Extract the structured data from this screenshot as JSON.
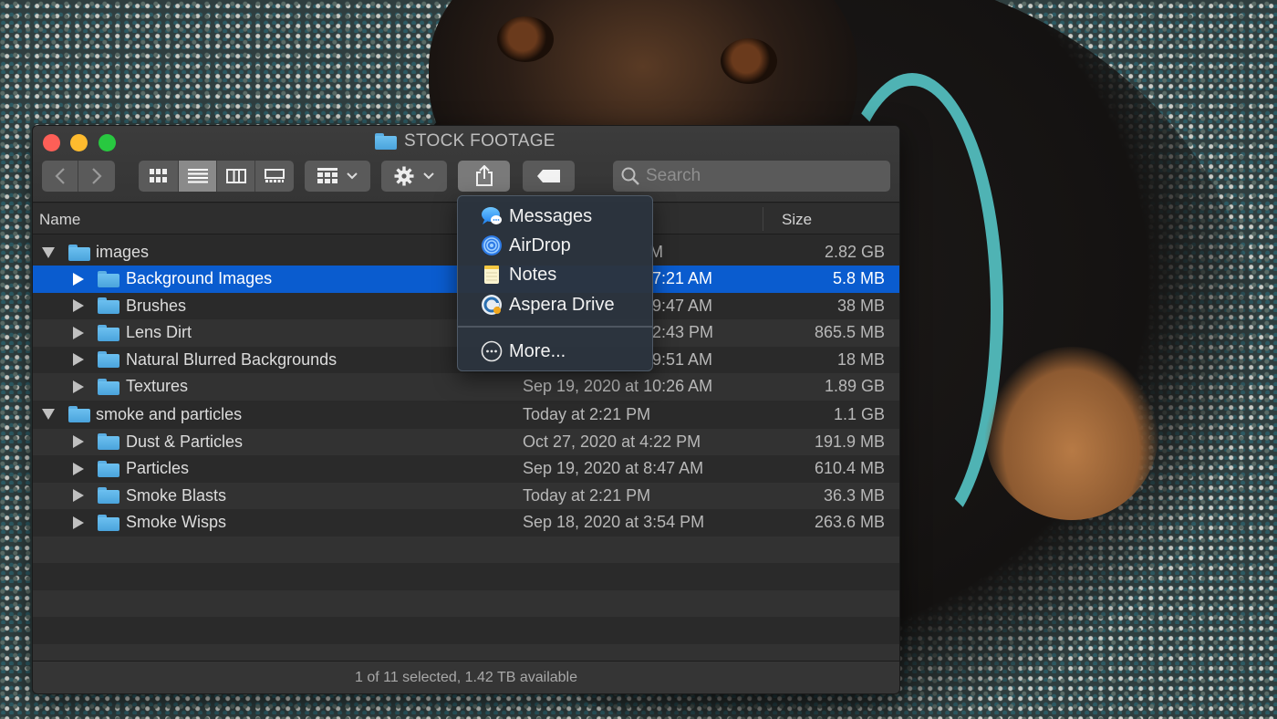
{
  "window": {
    "title": "STOCK FOOTAGE"
  },
  "toolbar": {
    "back_icon": "chevron-left-icon",
    "forward_icon": "chevron-right-icon",
    "view_modes": [
      "icon-view-icon",
      "list-view-icon",
      "column-view-icon",
      "gallery-view-icon"
    ],
    "active_view": "list-view-icon",
    "group_icon": "group-grid-icon",
    "action_icon": "gear-icon",
    "share_icon": "share-icon",
    "tag_icon": "tag-icon",
    "search_placeholder": "Search"
  },
  "columns": {
    "name": "Name",
    "size": "Size"
  },
  "rows": [
    {
      "name": "images",
      "date": "M",
      "size": "2.82 GB"
    },
    {
      "name": "Background Images",
      "date": "7:21 AM",
      "size": "5.8 MB"
    },
    {
      "name": "Brushes",
      "date": "9:47 AM",
      "size": "38 MB"
    },
    {
      "name": "Lens Dirt",
      "date": "2:43 PM",
      "size": "865.5 MB"
    },
    {
      "name": "Natural Blurred Backgrounds",
      "date": "9:51 AM",
      "size": "18 MB"
    },
    {
      "name": "Textures",
      "date": "Sep 19, 2020 at 10:26 AM",
      "size": "1.89 GB"
    },
    {
      "name": "smoke and particles",
      "date": "Today at 2:21 PM",
      "size": "1.1 GB"
    },
    {
      "name": "Dust & Particles",
      "date": "Oct 27, 2020 at 4:22 PM",
      "size": "191.9 MB"
    },
    {
      "name": "Particles",
      "date": "Sep 19, 2020 at 8:47 AM",
      "size": "610.4 MB"
    },
    {
      "name": "Smoke Blasts",
      "date": "Today at 2:21 PM",
      "size": "36.3 MB"
    },
    {
      "name": "Smoke Wisps",
      "date": "Sep 18, 2020 at 3:54 PM",
      "size": "263.6 MB"
    }
  ],
  "status": "1 of 11 selected, 1.42 TB available",
  "share_menu": {
    "items": [
      {
        "label": "Messages",
        "icon": "messages-icon"
      },
      {
        "label": "AirDrop",
        "icon": "airdrop-icon"
      },
      {
        "label": "Notes",
        "icon": "notes-icon"
      },
      {
        "label": "Aspera Drive",
        "icon": "aspera-drive-icon"
      }
    ],
    "more": {
      "label": "More...",
      "icon": "more-icon"
    }
  },
  "colors": {
    "selection": "#0a5ccf",
    "folder": "#5aaee3",
    "harness": "#4fb3b4"
  }
}
